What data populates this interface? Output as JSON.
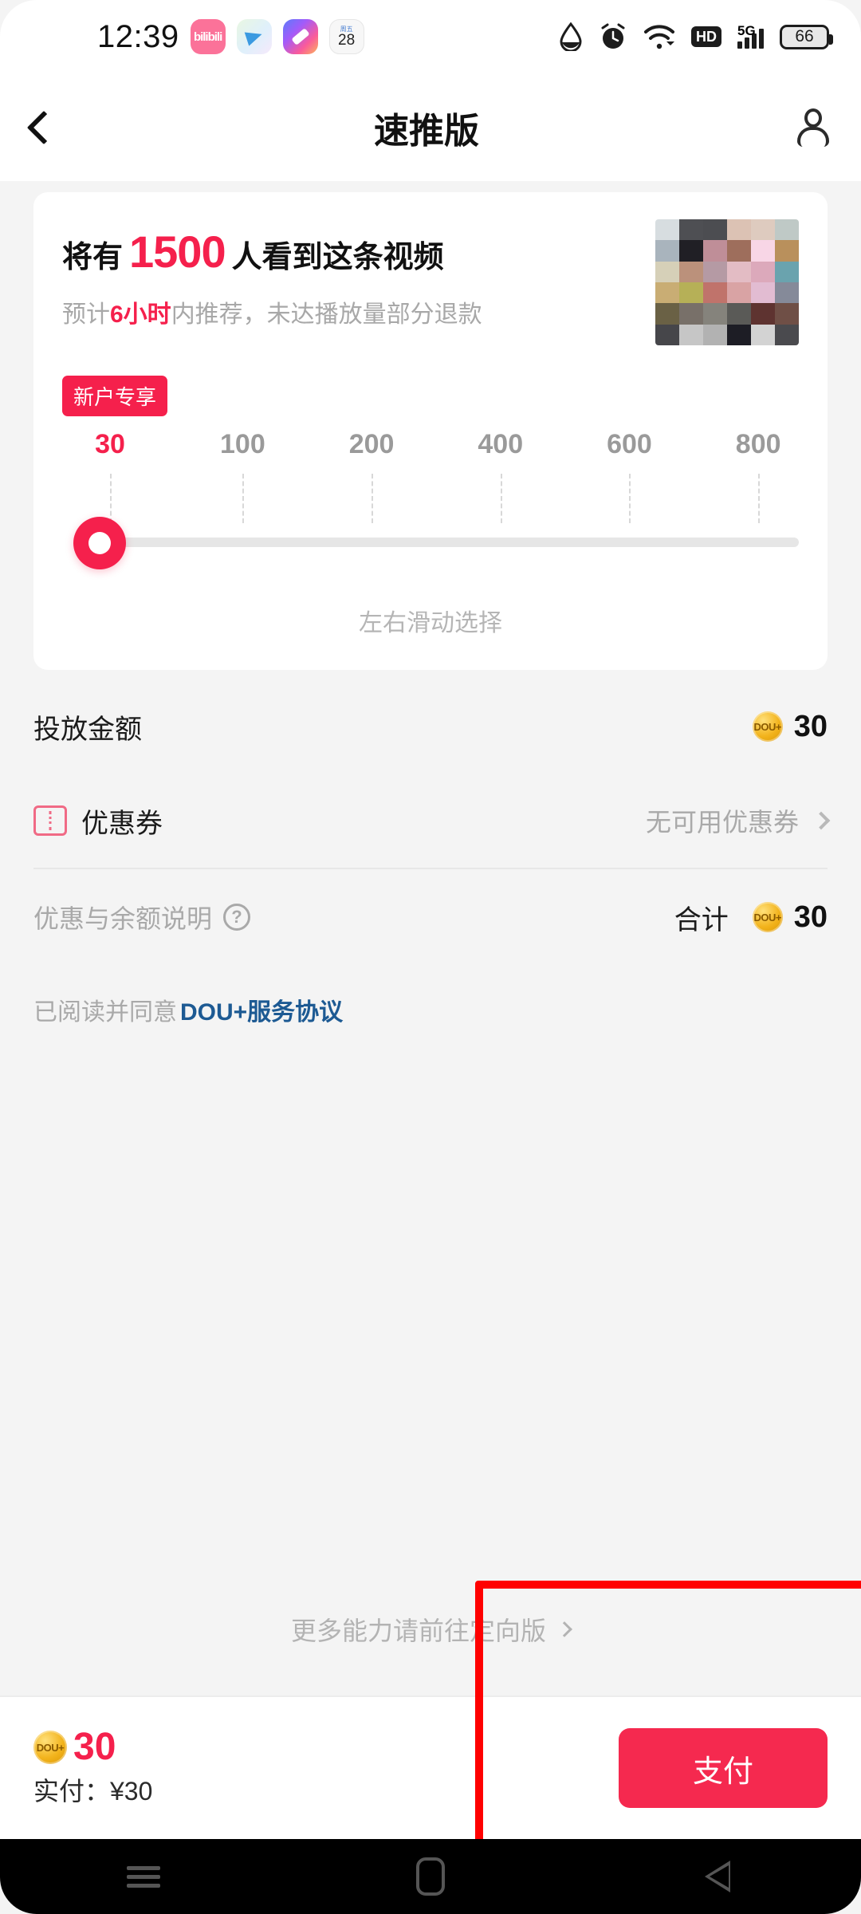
{
  "statusbar": {
    "time": "12:39",
    "app_icons": [
      {
        "name": "bilibili-app-icon",
        "label": "bilibili"
      },
      {
        "name": "telegram-app-icon",
        "label": ""
      },
      {
        "name": "photo-editor-app-icon",
        "label": ""
      },
      {
        "name": "calendar-app-icon",
        "weekday": "周五",
        "day": "28"
      }
    ],
    "indicators": {
      "water_drop": "water-drop-icon",
      "alarm": "alarm-clock-icon",
      "wifi": "wifi-icon",
      "hd": "HD",
      "network": "5G",
      "battery_level": "66"
    }
  },
  "appbar": {
    "back": "back-chevron",
    "title": "速推版",
    "account": "person-icon"
  },
  "promo_card": {
    "headline_prefix": "将有",
    "headline_number": "1500",
    "headline_suffix": "人看到这条视频",
    "sub_prefix": "预计",
    "sub_highlight": "6小时",
    "sub_suffix": "内推荐，未达播放量部分退款",
    "new_user_badge": "新户专享",
    "slider": {
      "ticks": [
        "30",
        "100",
        "200",
        "400",
        "600",
        "800"
      ],
      "selected_value": "30",
      "hint": "左右滑动选择"
    }
  },
  "rows": {
    "amount_label": "投放金额",
    "amount_value": "30",
    "coupon_label": "优惠券",
    "coupon_value": "无可用优惠券",
    "explain_label": "优惠与余额说明",
    "explain_help": "?",
    "total_label": "合计",
    "total_value": "30"
  },
  "agreement": {
    "prefix": "已阅读并同意",
    "link": "DOU+服务协议"
  },
  "more_link": "更多能力请前往定向版",
  "paybar": {
    "coin_value": "30",
    "actual_label": "实付：¥30",
    "pay_button": "支付"
  },
  "navbar": {
    "menu": "menu-icon",
    "home": "home-icon",
    "back": "back-icon"
  },
  "colors": {
    "accent_red": "#f5204c",
    "pay_button": "#f5294f",
    "link_blue": "#1d5a93",
    "annotation": "#ff0000"
  }
}
